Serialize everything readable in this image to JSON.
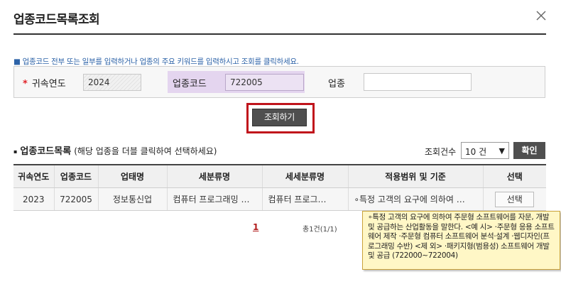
{
  "dialog": {
    "title": "업종코드목록조회",
    "close_icon": "close-icon"
  },
  "search": {
    "hint": "업종코드 전부 또는 일부를 입력하거나 업종의 주요 키워드를 입력하시고 조회를 클릭하세요.",
    "required_mark": "*",
    "year_label": "귀속연도",
    "year_value": "2024",
    "code_label": "업종코드",
    "code_value": "722005",
    "industry_label": "업종",
    "industry_value": "",
    "button_label": "조회하기",
    "highlight_color": "#e4d5ef",
    "annotation_color": "#c0141c"
  },
  "list": {
    "title": "업종코드목록",
    "subtitle": "(해당 업종을 더블 클릭하여 선택하세요)",
    "count_label": "조회건수",
    "count_value": "10 건",
    "confirm_label": "확인",
    "columns": [
      "귀속연도",
      "업종코드",
      "업태명",
      "세분류명",
      "세세분류명",
      "적용범위 및 기준",
      "선택"
    ],
    "rows": [
      {
        "year": "2023",
        "code": "722005",
        "business": "정보통신업",
        "sub_category": "컴퓨터 프로그래밍 …",
        "sub_sub_category": "컴퓨터 프로그…",
        "scope": "∘특정 고객의 요구에 의하여 …",
        "select_label": "선택"
      }
    ]
  },
  "pagination": {
    "current_page": "1",
    "total": "총1건(1/1)"
  },
  "tooltip": {
    "text": "∘특정 고객의 요구에 의하여 주문형 소프트웨어를 자문, 개발 및 공급하는 산업활동을 말한다. <예 시> ·주문형 응용 소프트웨어 제작 ·주문형 컴퓨터 소프트웨어 분석·설계 ·웹디자인(프로그래밍 수반) <제 외> ·패키지형(범용성) 소프트웨어 개발 및 공급 (722000~722004)"
  }
}
